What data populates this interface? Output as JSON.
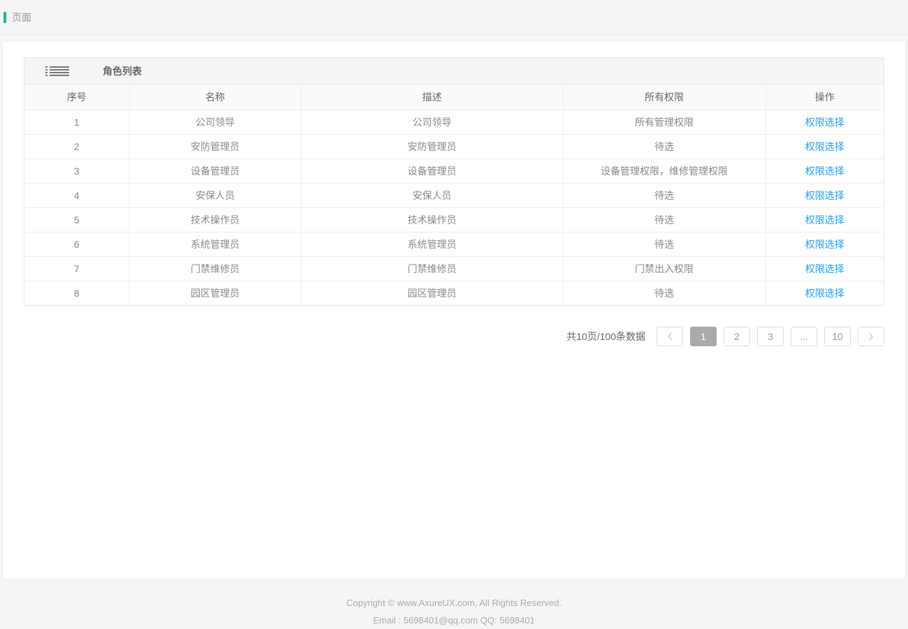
{
  "header": {
    "title": "页面"
  },
  "panel": {
    "title": "角色列表"
  },
  "columns": {
    "seq": "序号",
    "name": "名称",
    "desc": "描述",
    "perm": "所有权限",
    "op": "操作"
  },
  "rows": [
    {
      "seq": "1",
      "name": "公司领导",
      "desc": "公司领导",
      "perm": "所有管理权限",
      "op": "权限选择"
    },
    {
      "seq": "2",
      "name": "安防管理员",
      "desc": "安防管理员",
      "perm": "待选",
      "op": "权限选择"
    },
    {
      "seq": "3",
      "name": "设备管理员",
      "desc": "设备管理员",
      "perm": "设备管理权限，维修管理权限",
      "op": "权限选择"
    },
    {
      "seq": "4",
      "name": "安保人员",
      "desc": "安保人员",
      "perm": "待选",
      "op": "权限选择"
    },
    {
      "seq": "5",
      "name": "技术操作员",
      "desc": "技术操作员",
      "perm": "待选",
      "op": "权限选择"
    },
    {
      "seq": "6",
      "name": "系统管理员",
      "desc": "系统管理员",
      "perm": "待选",
      "op": "权限选择"
    },
    {
      "seq": "7",
      "name": "门禁维修员",
      "desc": "门禁维修员",
      "perm": "门禁出入权限",
      "op": "权限选择"
    },
    {
      "seq": "8",
      "name": "园区管理员",
      "desc": "园区管理员",
      "perm": "待选",
      "op": "权限选择"
    }
  ],
  "pagination": {
    "summary": "共10页/100条数据",
    "pages": [
      "1",
      "2",
      "3",
      "...",
      "10"
    ],
    "active": "1"
  },
  "footer": {
    "line1": "Copyright © www.AxureUX.com, All Rights Reserved.",
    "line2": "Email : 5698401@qq.com  QQ: 5698401"
  }
}
